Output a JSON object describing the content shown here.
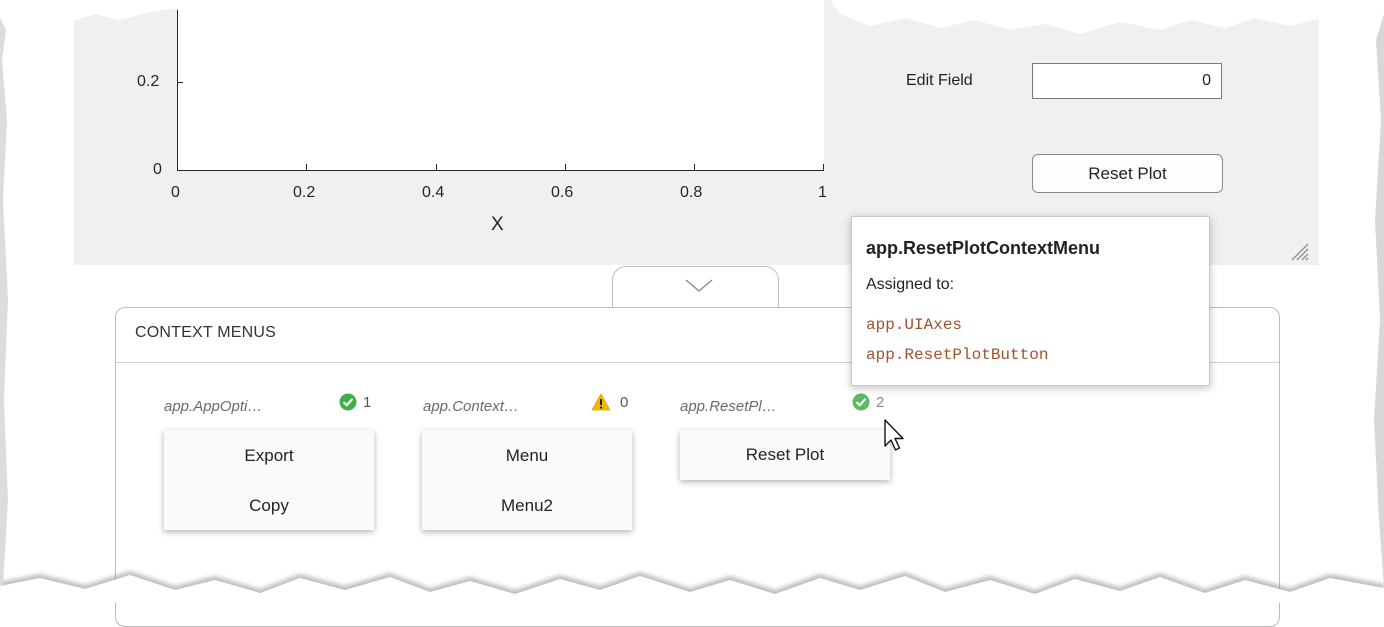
{
  "plot": {
    "y_ticks": [
      "0.2",
      "0"
    ],
    "x_ticks": [
      "0",
      "0.2",
      "0.4",
      "0.6",
      "0.8",
      "1"
    ],
    "x_axis_label": "X"
  },
  "edit_field": {
    "label": "Edit Field",
    "value": "0"
  },
  "reset_button": {
    "label": "Reset Plot"
  },
  "context_menus": {
    "title": "CONTEXT MENUS",
    "menus": [
      {
        "name": "app.AppOpti…",
        "status": "check",
        "count": "1",
        "items": [
          "Export",
          "Copy"
        ]
      },
      {
        "name": "app.Context…",
        "status": "warning",
        "count": "0",
        "items": [
          "Menu",
          "Menu2"
        ]
      },
      {
        "name": "app.ResetPl…",
        "status": "check",
        "count": "2",
        "items": [
          "Reset Plot"
        ]
      }
    ]
  },
  "tooltip": {
    "title": "app.ResetPlotContextMenu",
    "assigned_label": "Assigned to:",
    "targets": [
      "app.UIAxes",
      "app.ResetPlotButton"
    ]
  },
  "colors": {
    "check": "#3fae49",
    "warning": "#f2b700",
    "code": "#a0522d",
    "window_bg": "#f0f0f0"
  }
}
